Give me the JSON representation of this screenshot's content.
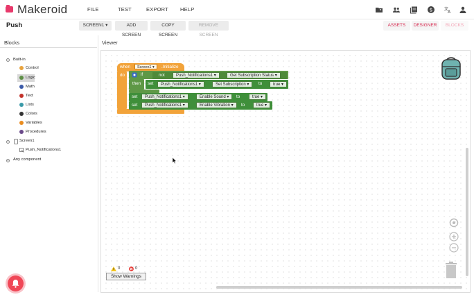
{
  "app": {
    "brand": "Makeroid",
    "brand_color": "#e8396b"
  },
  "menu": [
    "FILE",
    "TEST",
    "EXPORT",
    "HELP"
  ],
  "toolbar_icons": [
    "folder-add-icon",
    "people-icon",
    "library-icon",
    "dollar-icon",
    "translate-icon",
    "account-icon"
  ],
  "project": {
    "name": "Push"
  },
  "screen_buttons": {
    "screen_select": "SCREEN1 ▾",
    "add_screen": "ADD SCREEN",
    "copy_screen": "COPY SCREEN",
    "remove_screen": "REMOVE SCREEN"
  },
  "mode_buttons": {
    "assets": "ASSETS",
    "designer": "DESIGNER",
    "blocks": "BLOCKS"
  },
  "blocks_panel": {
    "title": "Blocks",
    "builtin_label": "Built-in",
    "items": [
      {
        "label": "Control",
        "color": "#e8a33d"
      },
      {
        "label": "Logic",
        "color": "#5e8f46"
      },
      {
        "label": "Math",
        "color": "#3b5aa8"
      },
      {
        "label": "Text",
        "color": "#c3322a"
      },
      {
        "label": "Lists",
        "color": "#3a9aa8"
      },
      {
        "label": "Colors",
        "color": "#333333"
      },
      {
        "label": "Variables",
        "color": "#ea8c1f"
      },
      {
        "label": "Procedures",
        "color": "#6a4a8a"
      }
    ],
    "screen_label": "Screen1",
    "component_label": "Push_Notifications1",
    "any_component": "Any component"
  },
  "viewer": {
    "title": "Viewer",
    "event": {
      "when": "when",
      "screen": "Screen1 ▾",
      "event": ".Initialize",
      "do": "do"
    },
    "if_block": {
      "if": "if",
      "then": "then",
      "not": "not",
      "component": "Push_Notifications1 ▾",
      "getter": "Get Subscription Status ▾"
    },
    "set_sub": {
      "set": "set",
      "component": "Push_Notifications1 ▾",
      "prop": "Set Subscription ▾",
      "to": "to",
      "value": "true ▾"
    },
    "set_sound": {
      "set": "set",
      "component": "Push_Notifications1 ▾",
      "prop": "Enable Sound ▾",
      "to": "to",
      "value": "true ▾"
    },
    "set_vibration": {
      "set": "set",
      "component": "Push_Notifications1 ▾",
      "prop": "Enable Vibration ▾",
      "to": "to",
      "value": "true ▾"
    },
    "warnings_count": "0",
    "errors_count": "0",
    "show_warnings": "Show Warnings"
  }
}
